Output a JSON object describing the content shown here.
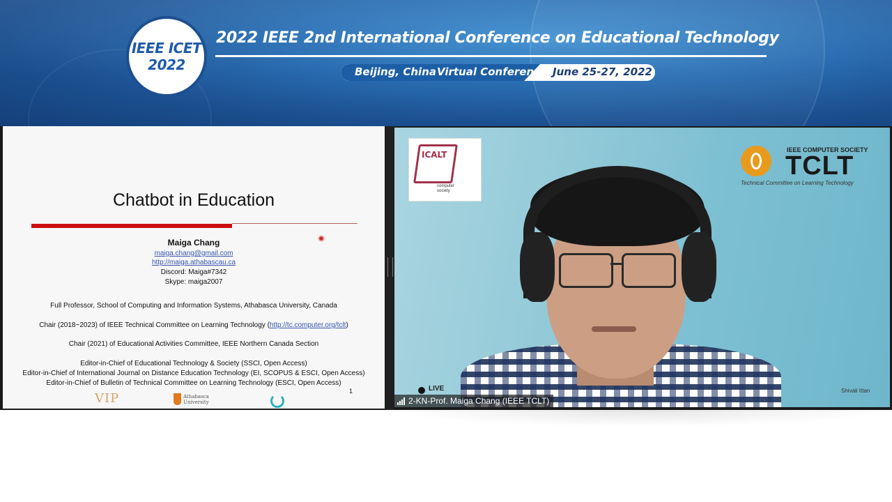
{
  "banner": {
    "logo_line1": "IEEE ICET",
    "logo_line2": "2022",
    "title": "2022 IEEE 2nd International Conference on Educational Technology",
    "location": "Beijing, China",
    "mode": "Virtual Conference",
    "dates": "June 25-27, 2022",
    "colors": {
      "primary": "#1e5aa8",
      "dark": "#153f78"
    }
  },
  "slide": {
    "title": "Chatbot in Education",
    "name": "Maiga Chang",
    "email": "maiga.chang@gmail.com",
    "website": "http://maiga.athabascau.ca",
    "discord": "Discord: Maiga#7342",
    "skype": "Skype: maiga2007",
    "line_professor": "Full Professor, School of Computing and Information Systems, Athabasca University, Canada",
    "line_chair_tclt_prefix": "Chair (2018~2023) of IEEE Technical Committee on Learning Technology (",
    "line_chair_tclt_link": "http://tc.computer.org/tclt",
    "line_chair_tclt_suffix": ")",
    "line_chair_eac": "Chair (2021) of Educational Activities Committee, IEEE Northern Canada Section",
    "line_eic_1": "Editor-in-Chief of Educational Technology & Society (SSCI, Open Access)",
    "line_eic_2": "Editor-in-Chief of International Journal on Distance Education Technology (EI, SCOPUS & ESCI, Open Access)",
    "line_eic_3": "Editor-in-Chief of Bulletin of Technical Committee on Learning Technology (ESCI, Open Access)",
    "page_number": "1",
    "footer_logo_1": "VIP",
    "footer_logo_2_line1": "Athabasca",
    "footer_logo_2_line2": "University"
  },
  "video": {
    "icalt_logo": "ICALT",
    "icalt_sub_1": "computer",
    "icalt_sub_2": "society",
    "tclt_sub": "IEEE COMPUTER SOCIETY",
    "tclt_main": "TCLT",
    "tclt_caption": "Technical Committee on Learning Technology",
    "live_label": "LIVE",
    "corner_name": "Shivali Ittan",
    "participant_name": "2-KN-Prof. Maiga Chang (IEEE TCLT)"
  }
}
